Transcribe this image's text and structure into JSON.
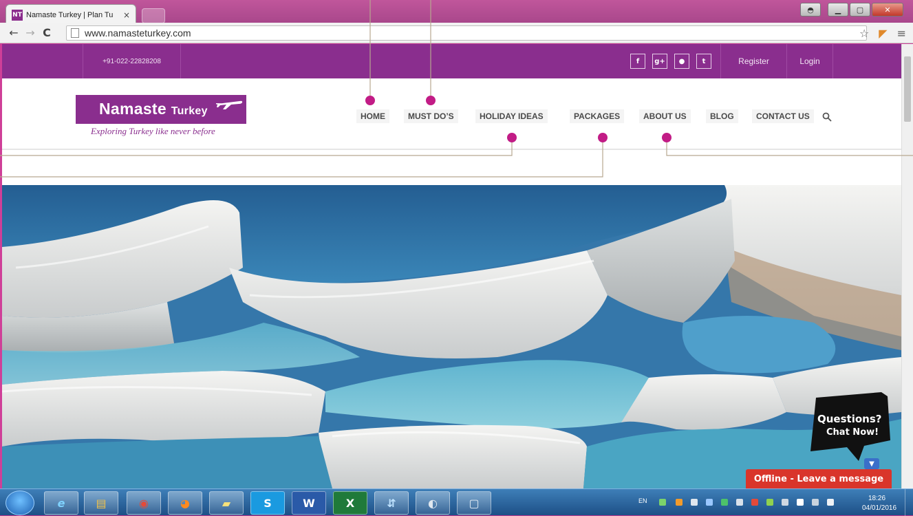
{
  "browser": {
    "tab_title": "Namaste Turkey | Plan Tu",
    "tab_close": "×",
    "favicon_text": "NT",
    "url": "www.namasteturkey.com",
    "back": "←",
    "forward": "→",
    "reload": "C"
  },
  "site": {
    "phone": "+91-022-22828208",
    "social": [
      "f",
      "g+",
      "●",
      "t"
    ],
    "register": "Register",
    "login": "Login",
    "logo_name": "Namaste",
    "logo_name_small": "Turkey",
    "logo_tagline": "Exploring Turkey like never before",
    "nav": [
      "HOME",
      "MUST DO’S",
      "HOLIDAY IDEAS",
      "PACKAGES",
      "ABOUT US",
      "BLOG",
      "CONTACT US"
    ]
  },
  "chat": {
    "line1": "Questions?",
    "line2": "Chat Now!",
    "offline": "Offline - Leave a message"
  },
  "taskbar": {
    "lang": "EN",
    "time": "18:26",
    "date": "04/01/2016",
    "apps": [
      "e",
      "▤",
      "◉",
      "◕",
      "▰",
      "S",
      "W",
      "X",
      "⇵",
      "◐",
      "▢"
    ]
  },
  "colors": {
    "brand_purple": "#8a2e8e",
    "annotation_pink": "#c21c86",
    "offline_red": "#d9352b"
  }
}
